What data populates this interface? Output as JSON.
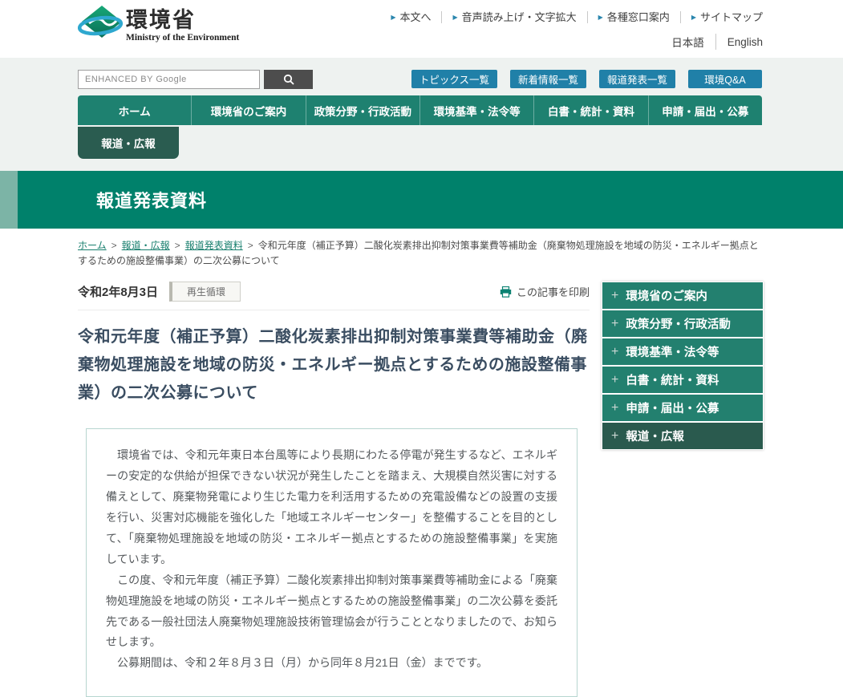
{
  "header": {
    "logo": {
      "title": "環境省",
      "subtitle": "Ministry of the Environment"
    },
    "utility_links": [
      "本文へ",
      "音声読み上げ・文字拡大",
      "各種窓口案内",
      "サイトマップ"
    ],
    "language": {
      "japanese": "日本語",
      "english": "English"
    }
  },
  "search": {
    "placeholder": "ENHANCED BY Google"
  },
  "quick_links": [
    "トピックス一覧",
    "新着情報一覧",
    "報道発表一覧",
    "環境Q&A"
  ],
  "nav": {
    "items": [
      "ホーム",
      "環境省のご案内",
      "政策分野・行政活動",
      "環境基準・法令等",
      "白書・統計・資料",
      "申請・届出・公募"
    ],
    "active_tab": "報道・広報"
  },
  "banner": {
    "title": "報道発表資料"
  },
  "breadcrumb": {
    "links": [
      "ホーム",
      "報道・広報",
      "報道発表資料"
    ],
    "separator": ">",
    "current": "令和元年度（補正予算）二酸化炭素排出抑制対策事業費等補助金（廃棄物処理施設を地域の防災・エネルギー拠点とするための施設整備事業）の二次公募について"
  },
  "article": {
    "date": "令和2年8月3日",
    "category_tag": "再生循環",
    "print_label": "この記事を印刷",
    "title": "令和元年度（補正予算）二酸化炭素排出抑制対策事業費等補助金（廃棄物処理施設を地域の防災・エネルギー拠点とするための施設整備事業）の二次公募について",
    "paragraphs": [
      "　環境省では、令和元年東日本台風等により長期にわたる停電が発生するなど、エネルギーの安定的な供給が担保できない状況が発生したことを踏まえ、大規模自然災害に対する備えとして、廃棄物発電により生じた電力を利活用するための充電設備などの設置の支援を行い、災害対応機能を強化した「地域エネルギーセンター」を整備することを目的として、「廃棄物処理施設を地域の防災・エネルギー拠点とするための施設整備事業」を実施しています。",
      "　この度、令和元年度（補正予算）二酸化炭素排出抑制対策事業費等補助金による「廃棄物処理施設を地域の防災・エネルギー拠点とするための施設整備事業」の二次公募を委託先である一般社団法人廃棄物処理施設技術管理協会が行うこととなりましたので、お知らせします。",
      "　公募期間は、令和２年８月３日（月）から同年８月21日（金）までです。"
    ]
  },
  "sidebar": {
    "items": [
      {
        "label": "環境省のご案内",
        "active": false
      },
      {
        "label": "政策分野・行政活動",
        "active": false
      },
      {
        "label": "環境基準・法令等",
        "active": false
      },
      {
        "label": "白書・統計・資料",
        "active": false
      },
      {
        "label": "申請・届出・公募",
        "active": false
      },
      {
        "label": "報道・広報",
        "active": true
      }
    ]
  },
  "colors": {
    "nav_green": "#1e8170",
    "active_dark_green": "#2a5c50",
    "banner_green": "#00816b",
    "banner_strip": "#7cb4a6",
    "button_blue": "#2080a8",
    "link_teal": "#187f6e",
    "band_bg": "#eef2f0",
    "title_slate": "#3a4d61"
  }
}
